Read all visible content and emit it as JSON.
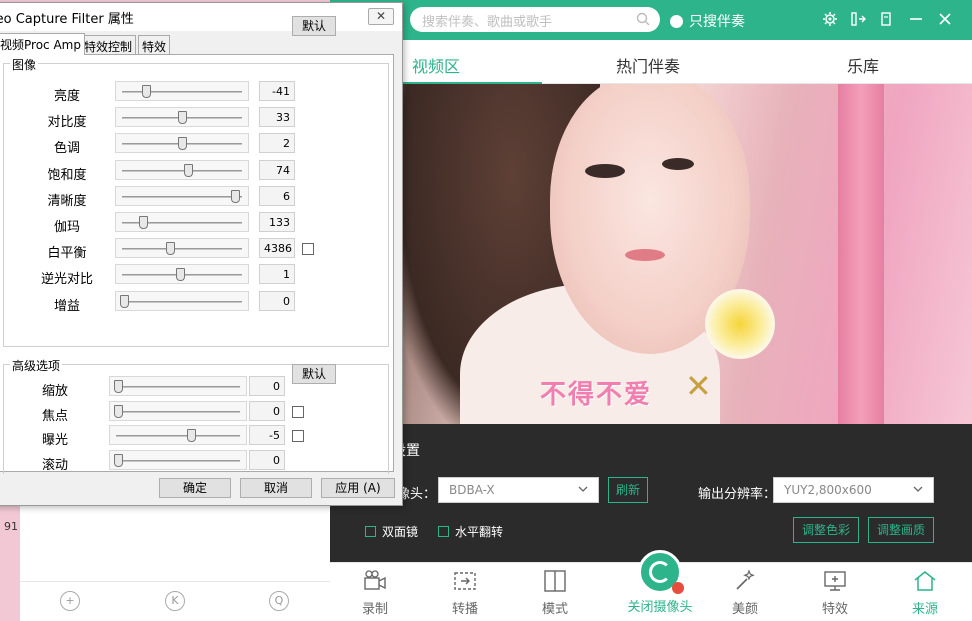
{
  "dialog": {
    "title": "leo Capture Filter 属性",
    "close_glyph": "✕",
    "tabs": [
      "视频Proc Amp",
      "特效控制",
      "特效"
    ],
    "image_group": {
      "label": "图像",
      "default_button": "默认",
      "rows": [
        {
          "name": "亮度",
          "value": "-41",
          "pos": 0.19
        },
        {
          "name": "对比度",
          "value": "33",
          "pos": 0.5
        },
        {
          "name": "色调",
          "value": "2",
          "pos": 0.5
        },
        {
          "name": "饱和度",
          "value": "74",
          "pos": 0.55
        },
        {
          "name": "清晰度",
          "value": "6",
          "pos": 0.96
        },
        {
          "name": "伽玛",
          "value": "133",
          "pos": 0.16
        },
        {
          "name": "白平衡",
          "value": "4386",
          "pos": 0.4
        },
        {
          "name": "逆光对比",
          "value": "1",
          "pos": 0.48
        },
        {
          "name": "增益",
          "value": "0",
          "pos": 0.0
        }
      ]
    },
    "advanced_group": {
      "label": "高级选项",
      "default_button": "默认",
      "rows": [
        {
          "name": "缩放",
          "value": "0",
          "pos": 0.0
        },
        {
          "name": "焦点",
          "value": "0",
          "pos": 0.0
        },
        {
          "name": "曝光",
          "value": "-5",
          "pos": 0.61
        },
        {
          "name": "滚动",
          "value": "0",
          "pos": 0.0
        }
      ]
    },
    "buttons": {
      "ok": "确定",
      "cancel": "取消",
      "apply": "应用 (A)"
    }
  },
  "app": {
    "search_placeholder": "搜索伴奏、歌曲或歌手",
    "only_accompaniment": "只搜伴奏",
    "tabs": {
      "video": "视频区",
      "hot": "热门伴奏",
      "library": "乐库"
    },
    "video_overlay": {
      "text": "不得不爱",
      "mark": "✕"
    },
    "camera_settings": {
      "title": "设置",
      "camera_label": "像头：",
      "camera_value": "BDBA-X",
      "refresh": "刷新",
      "resolution_label": "输出分辨率：",
      "resolution_value": "YUY2,800x600",
      "mirror": "双面镜",
      "flip": "水平翻转",
      "adjust_color": "调整色彩",
      "adjust_quality": "调整画质"
    },
    "bottom_bar": {
      "record": "录制",
      "relay": "转播",
      "mode": "模式",
      "close_camera": "关闭摄像头",
      "beauty": "美颜",
      "effects": "特效",
      "source": "来源"
    }
  },
  "left_panel": {
    "icons": [
      "+",
      "K",
      "Q"
    ],
    "desktop_label": "91"
  },
  "colors": {
    "accent": "#2db48a",
    "dark_panel": "#2b2b2b"
  }
}
